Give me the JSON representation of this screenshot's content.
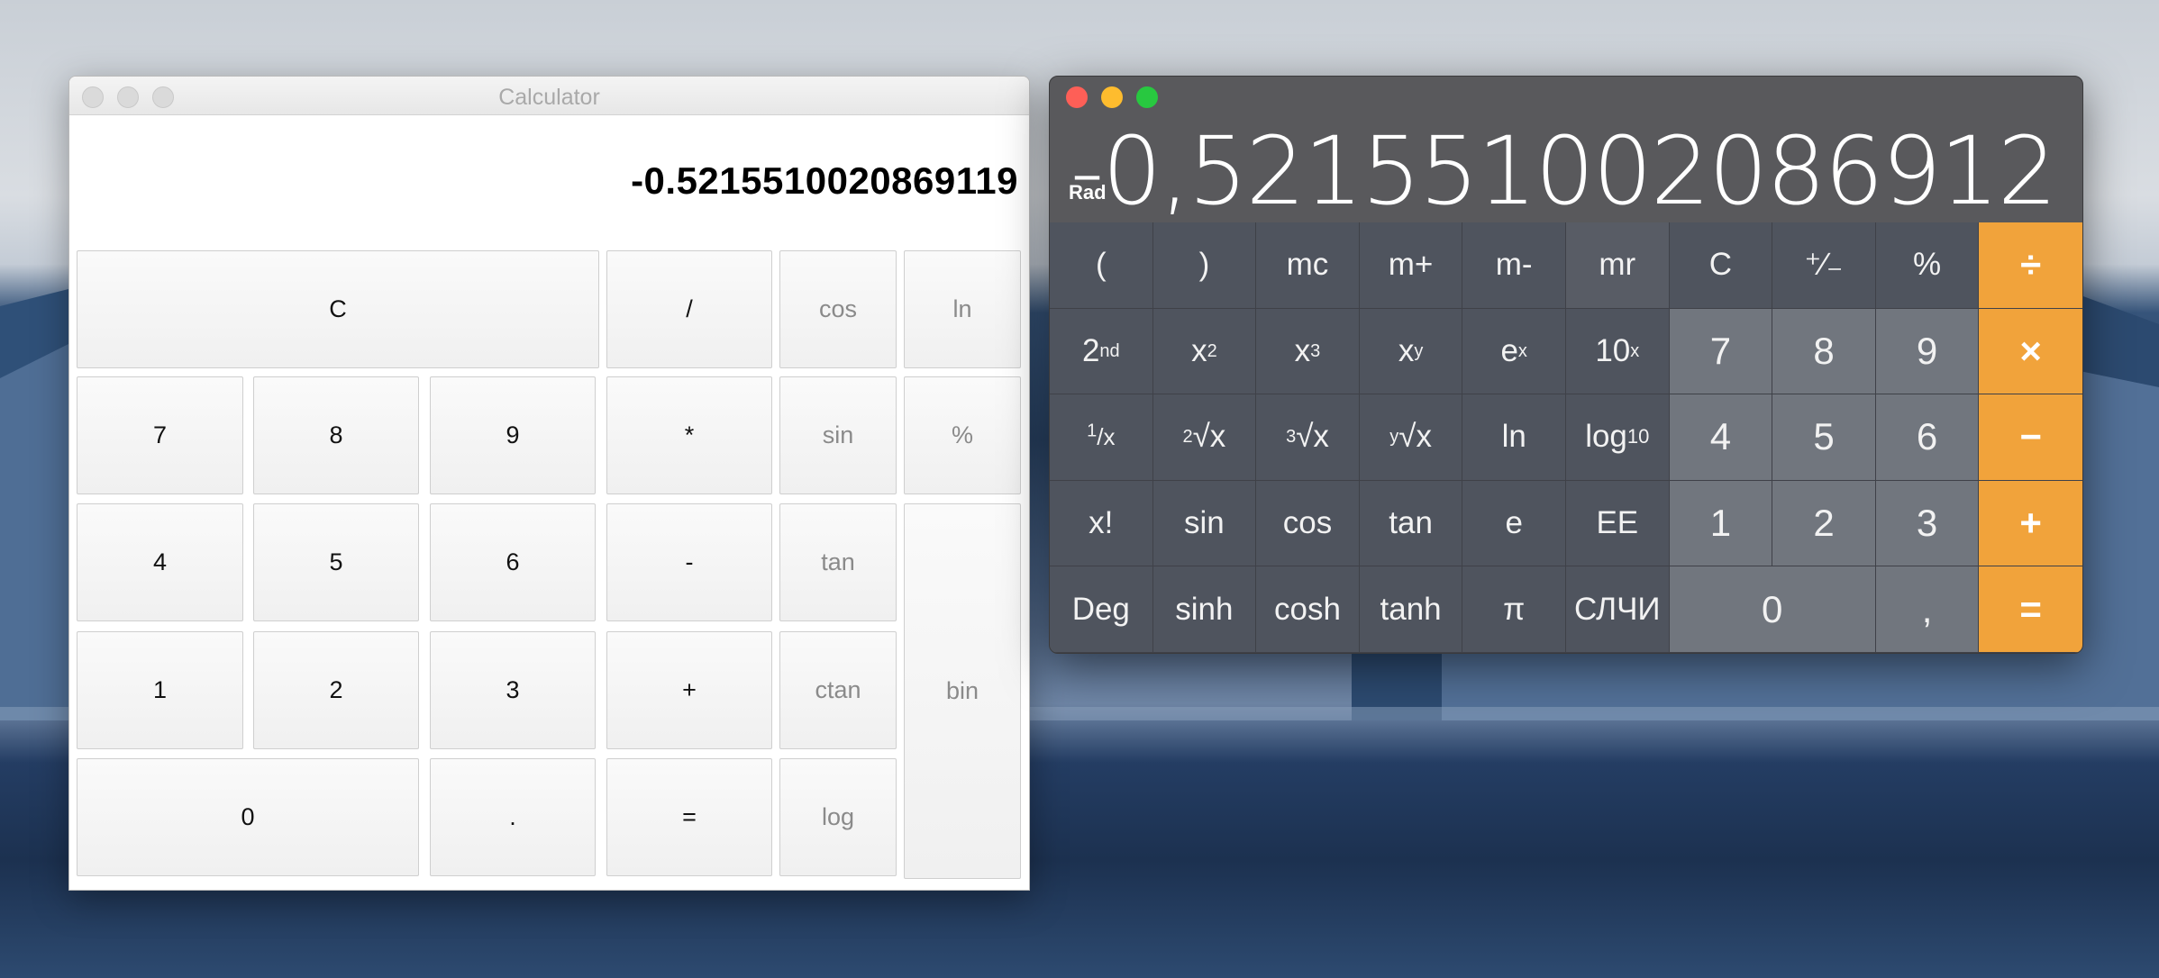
{
  "left_calculator": {
    "title": "Calculator",
    "display": "-0.5215510020869119",
    "buttons": {
      "clear": "C",
      "divide": "/",
      "cos": "cos",
      "ln": "ln",
      "seven": "7",
      "eight": "8",
      "nine": "9",
      "multiply": "*",
      "sin": "sin",
      "percent": "%",
      "four": "4",
      "five": "5",
      "six": "6",
      "minus": "-",
      "tan": "tan",
      "bin": "bin",
      "one": "1",
      "two": "2",
      "three": "3",
      "plus": "+",
      "ctan": "ctan",
      "zero": "0",
      "dot": ".",
      "equals": "=",
      "log": "log"
    }
  },
  "right_calculator": {
    "mode": "Rad",
    "display": "-0,521551002086912",
    "colors": {
      "operator": "#f1a33b",
      "close": "#fe5f57",
      "minimize": "#febc2e",
      "maximize": "#28c840"
    },
    "rows": [
      [
        "(",
        ")",
        "mc",
        "m+",
        "m-",
        "mr",
        "C",
        "⁺∕₋",
        "%",
        "÷"
      ],
      [
        "2nd",
        "x2",
        "x3",
        "xy",
        "ex",
        "10x",
        "7",
        "8",
        "9",
        "×"
      ],
      [
        "1/x",
        "2√x",
        "3√x",
        "y√x",
        "ln",
        "log10",
        "4",
        "5",
        "6",
        "−"
      ],
      [
        "x!",
        "sin",
        "cos",
        "tan",
        "e",
        "EE",
        "1",
        "2",
        "3",
        "+"
      ],
      [
        "Deg",
        "sinh",
        "cosh",
        "tanh",
        "π",
        "СЛЧИ",
        "0",
        ",",
        "="
      ]
    ]
  }
}
